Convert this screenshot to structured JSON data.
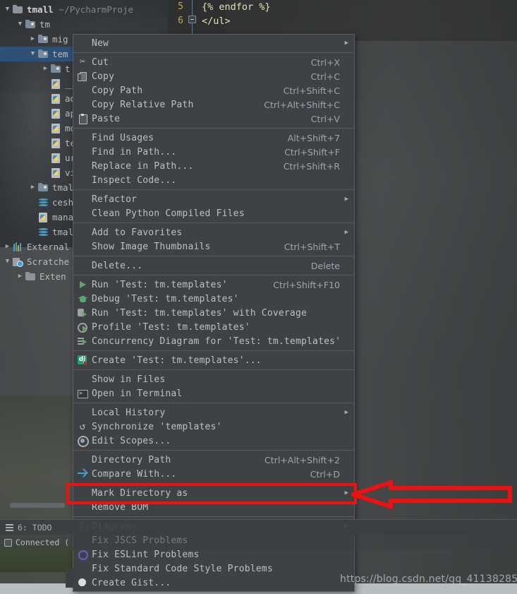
{
  "app": {
    "project_root": "tmall",
    "project_path": "~/PycharmProjects"
  },
  "editor": {
    "line_numbers": [
      "5",
      "6"
    ],
    "lines": [
      "{% endfor %}",
      "</ul>"
    ]
  },
  "tree": {
    "items": [
      {
        "label": "tmall",
        "path": "~/PycharmProje",
        "icon": "folder-icon",
        "arrow": "down",
        "depth": 0,
        "root": true,
        "selected": false
      },
      {
        "label": "tm",
        "path": "",
        "icon": "folder-src-icon",
        "arrow": "down",
        "depth": 1,
        "root": false,
        "selected": false
      },
      {
        "label": "mig",
        "path": "",
        "icon": "folder-src-icon",
        "arrow": "right",
        "depth": 2,
        "root": false,
        "selected": false
      },
      {
        "label": "tem",
        "path": "",
        "icon": "folder-src-icon",
        "arrow": "down",
        "depth": 2,
        "root": false,
        "selected": true
      },
      {
        "label": "t",
        "path": "",
        "icon": "folder-src-icon",
        "arrow": "right",
        "depth": 3,
        "root": false,
        "selected": false
      },
      {
        "label": "__i",
        "path": "",
        "icon": "python-file-icon",
        "arrow": "none",
        "depth": 3,
        "root": false,
        "selected": false
      },
      {
        "label": "adm",
        "path": "",
        "icon": "python-file-icon",
        "arrow": "none",
        "depth": 3,
        "root": false,
        "selected": false
      },
      {
        "label": "app",
        "path": "",
        "icon": "python-file-icon",
        "arrow": "none",
        "depth": 3,
        "root": false,
        "selected": false
      },
      {
        "label": "mod",
        "path": "",
        "icon": "python-file-icon",
        "arrow": "none",
        "depth": 3,
        "root": false,
        "selected": false
      },
      {
        "label": "tes",
        "path": "",
        "icon": "python-file-icon",
        "arrow": "none",
        "depth": 3,
        "root": false,
        "selected": false
      },
      {
        "label": "url",
        "path": "",
        "icon": "python-file-icon",
        "arrow": "none",
        "depth": 3,
        "root": false,
        "selected": false
      },
      {
        "label": "vie",
        "path": "",
        "icon": "python-file-icon",
        "arrow": "none",
        "depth": 3,
        "root": false,
        "selected": false
      },
      {
        "label": "tmall",
        "path": "",
        "icon": "folder-src-icon",
        "arrow": "right",
        "depth": 2,
        "root": false,
        "selected": false
      },
      {
        "label": "ceshi",
        "path": "",
        "icon": "database-icon",
        "arrow": "none",
        "depth": 2,
        "root": false,
        "selected": false
      },
      {
        "label": "manag",
        "path": "",
        "icon": "python-file-icon",
        "arrow": "none",
        "depth": 2,
        "root": false,
        "selected": false
      },
      {
        "label": "tmall",
        "path": "",
        "icon": "database-icon",
        "arrow": "none",
        "depth": 2,
        "root": false,
        "selected": false
      },
      {
        "label": "External",
        "path": "",
        "icon": "external-libraries-icon",
        "arrow": "right",
        "depth": 0,
        "root": false,
        "selected": false
      },
      {
        "label": "Scratche",
        "path": "",
        "icon": "scratches-icon",
        "arrow": "down",
        "depth": 0,
        "root": false,
        "selected": false
      },
      {
        "label": "Exten",
        "path": "",
        "icon": "folder-icon",
        "arrow": "right",
        "depth": 1,
        "root": false,
        "selected": false
      }
    ]
  },
  "context_menu": {
    "groups": [
      {
        "items": [
          {
            "label": "New",
            "accel": "",
            "icon": "",
            "submenu": true
          }
        ]
      },
      {
        "items": [
          {
            "label": "Cut",
            "accel": "Ctrl+X",
            "icon": "cut-icon",
            "submenu": false
          },
          {
            "label": "Copy",
            "accel": "Ctrl+C",
            "icon": "copy-icon",
            "submenu": false
          },
          {
            "label": "Copy Path",
            "accel": "Ctrl+Shift+C",
            "icon": "",
            "submenu": false
          },
          {
            "label": "Copy Relative Path",
            "accel": "Ctrl+Alt+Shift+C",
            "icon": "",
            "submenu": false
          },
          {
            "label": "Paste",
            "accel": "Ctrl+V",
            "icon": "paste-icon",
            "submenu": false
          }
        ]
      },
      {
        "items": [
          {
            "label": "Find Usages",
            "accel": "Alt+Shift+7",
            "icon": "",
            "submenu": false
          },
          {
            "label": "Find in Path...",
            "accel": "Ctrl+Shift+F",
            "icon": "",
            "submenu": false
          },
          {
            "label": "Replace in Path...",
            "accel": "Ctrl+Shift+R",
            "icon": "",
            "submenu": false
          },
          {
            "label": "Inspect Code...",
            "accel": "",
            "icon": "",
            "submenu": false
          }
        ]
      },
      {
        "items": [
          {
            "label": "Refactor",
            "accel": "",
            "icon": "",
            "submenu": true
          },
          {
            "label": "Clean Python Compiled Files",
            "accel": "",
            "icon": "",
            "submenu": false
          }
        ]
      },
      {
        "items": [
          {
            "label": "Add to Favorites",
            "accel": "",
            "icon": "",
            "submenu": true
          },
          {
            "label": "Show Image Thumbnails",
            "accel": "Ctrl+Shift+T",
            "icon": "",
            "submenu": false
          }
        ]
      },
      {
        "items": [
          {
            "label": "Delete...",
            "accel": "Delete",
            "icon": "",
            "submenu": false
          }
        ]
      },
      {
        "items": [
          {
            "label": "Run 'Test: tm.templates'",
            "accel": "Ctrl+Shift+F10",
            "icon": "run-icon",
            "submenu": false
          },
          {
            "label": "Debug 'Test: tm.templates'",
            "accel": "",
            "icon": "debug-icon",
            "submenu": false
          },
          {
            "label": "Run 'Test: tm.templates' with Coverage",
            "accel": "",
            "icon": "coverage-icon",
            "submenu": false
          },
          {
            "label": "Profile 'Test: tm.templates'",
            "accel": "",
            "icon": "profile-icon",
            "submenu": false
          },
          {
            "label": "Concurrency Diagram for 'Test: tm.templates'",
            "accel": "",
            "icon": "concurrency-icon",
            "submenu": false
          }
        ]
      },
      {
        "items": [
          {
            "label": "Create 'Test: tm.templates'...",
            "accel": "",
            "icon": "create-config-icon",
            "submenu": false
          }
        ]
      },
      {
        "items": [
          {
            "label": "Show in Files",
            "accel": "",
            "icon": "",
            "submenu": false
          },
          {
            "label": "Open in Terminal",
            "accel": "",
            "icon": "terminal-icon",
            "submenu": false
          }
        ]
      },
      {
        "items": [
          {
            "label": "Local History",
            "accel": "",
            "icon": "",
            "submenu": true
          },
          {
            "label": "Synchronize 'templates'",
            "accel": "",
            "icon": "synchronize-icon",
            "submenu": false
          },
          {
            "label": "Edit Scopes...",
            "accel": "",
            "icon": "scopes-icon",
            "submenu": false
          }
        ]
      },
      {
        "items": [
          {
            "label": "Directory Path",
            "accel": "Ctrl+Alt+Shift+2",
            "icon": "",
            "submenu": false
          },
          {
            "label": "Compare With...",
            "accel": "Ctrl+D",
            "icon": "compare-icon",
            "submenu": false
          }
        ]
      },
      {
        "items": [
          {
            "label": "Mark Directory as",
            "accel": "",
            "icon": "",
            "submenu": true,
            "highlighted": true
          },
          {
            "label": "Remove BOM",
            "accel": "",
            "icon": "",
            "submenu": false
          }
        ]
      },
      {
        "items": [
          {
            "label": "Diagrams",
            "accel": "",
            "icon": "diagrams-icon",
            "submenu": true
          },
          {
            "label": "Fix JSCS Problems",
            "accel": "",
            "icon": "",
            "submenu": false
          },
          {
            "label": "Fix ESLint Problems",
            "accel": "",
            "icon": "eslint-icon",
            "submenu": false
          },
          {
            "label": "Fix Standard Code Style Problems",
            "accel": "",
            "icon": "",
            "submenu": false
          },
          {
            "label": "Create Gist...",
            "accel": "",
            "icon": "gist-icon",
            "submenu": false
          }
        ]
      }
    ]
  },
  "tool_window_bar": {
    "todo_label": "6: TODO"
  },
  "status_bar": {
    "text": "Connected ("
  },
  "annotation": {
    "highlight_target": "Mark Directory as",
    "color": "#ee1111"
  },
  "watermark": {
    "text": "https://blog.csdn.net/qq_41138285"
  }
}
